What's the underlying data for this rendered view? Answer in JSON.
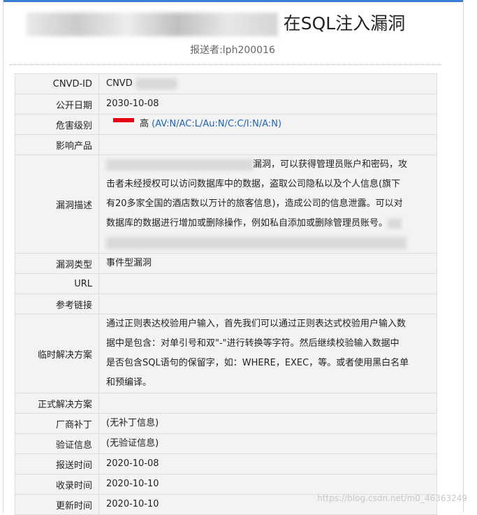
{
  "header": {
    "title_visible": "在SQL注入漏洞",
    "submitter": "报送者:lph200016"
  },
  "colors": {
    "accent": "#3a7fd5",
    "severity_bar": "#e60012",
    "link": "#1e63b8"
  },
  "rows": {
    "cnvd_id": {
      "label": "CNVD-ID",
      "value": "CNVD"
    },
    "publish_date": {
      "label": "公开日期",
      "value": "2030-10-08"
    },
    "severity": {
      "label": "危害级别",
      "value": "高",
      "vector": "(AV:N/AC:L/Au:N/C:C/I:N/A:N)"
    },
    "affected": {
      "label": "影响产品",
      "value": ""
    },
    "description": {
      "label": "漏洞描述",
      "line1": "漏洞，可以获得管理员账户和密码，攻",
      "line2": "击者未经授权可以访问数据库中的数据，盗取公司隐私以及个人信息(旗下",
      "line3": "有20多家全国的酒店数以万计的旅客信息)，造成公司的信息泄露。可以对",
      "line4": "数据库的数据进行增加或删除操作，例如私自添加或删除管理员账号。"
    },
    "type": {
      "label": "漏洞类型",
      "value": "事件型漏洞"
    },
    "url": {
      "label": "URL",
      "value": ""
    },
    "refs": {
      "label": "参考链接",
      "value": ""
    },
    "temp_solution": {
      "label": "临时解决方案",
      "line1": "通过正则表达校验用户输入，首先我们可以通过正则表达式校验用户输入数",
      "line2": "据中是包含：对单引号和双\"-\"进行转换等字符。然后继续校验输入数据中",
      "line3": "是否包含SQL语句的保留字，如：WHERE，EXEC，等。或者使用黑白名单",
      "line4": "和预编译。"
    },
    "formal_solution": {
      "label": "正式解决方案",
      "value": ""
    },
    "patch": {
      "label": "厂商补丁",
      "value": "(无补丁信息)"
    },
    "verify": {
      "label": "验证信息",
      "value": "(无验证信息)"
    },
    "report_time": {
      "label": "报送时间",
      "value": "2020-10-08"
    },
    "record_time": {
      "label": "收录时间",
      "value": "2020-10-10"
    },
    "update_time": {
      "label": "更新时间",
      "value": "2020-10-10"
    }
  },
  "watermark": "https://blog.csdn.net/m0_46363249"
}
